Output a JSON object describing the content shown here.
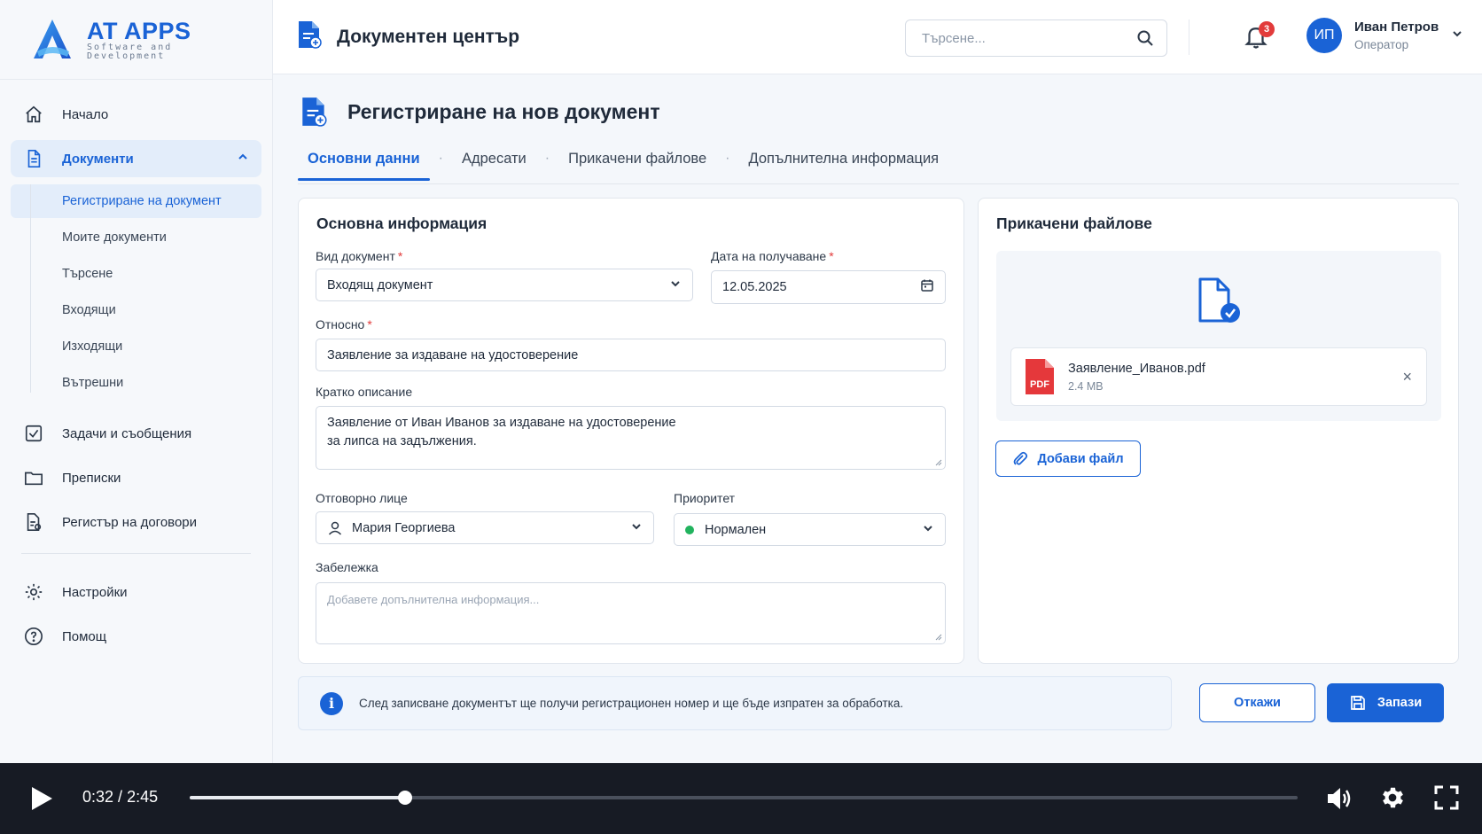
{
  "brand": {
    "title": "AT APPS",
    "subtitle_line1": "Software and",
    "subtitle_line2": "Development"
  },
  "sidebar": {
    "items": [
      {
        "label": "Начало",
        "icon": "home-icon"
      },
      {
        "label": "Документи",
        "icon": "document-icon",
        "active": true
      },
      {
        "label": "Задачи и съобщения",
        "icon": "checkbox-icon"
      },
      {
        "label": "Преписки",
        "icon": "folder-icon"
      },
      {
        "label": "Регистър на договори",
        "icon": "contract-icon"
      },
      {
        "label": "Настройки",
        "icon": "gear-icon"
      },
      {
        "label": "Помощ",
        "icon": "help-icon"
      }
    ],
    "sub_items": [
      "Регистриране на документ",
      "Моите документи",
      "Търсене",
      "Входящи",
      "Изходящи",
      "Вътрешни"
    ]
  },
  "topbar": {
    "title": "Документен център",
    "search_placeholder": "Търсене...",
    "notifications_count": "3",
    "user": {
      "initials": "ИП",
      "name": "Иван Петров",
      "role": "Оператор"
    }
  },
  "page": {
    "title": "Регистриране на нов документ",
    "tabs": [
      "Основни данни",
      "Адресати",
      "Прикачени файлове",
      "Допълнителна информация"
    ]
  },
  "form": {
    "title": "Основна информация",
    "doc_type": {
      "label": "Вид документ",
      "value": "Входящ документ"
    },
    "date": {
      "label": "Дата на получаване",
      "value": "12.05.2025"
    },
    "subject": {
      "label": "Относно",
      "value": "Заявление за издаване на удостоверение"
    },
    "description": {
      "label": "Кратко описание",
      "line1": "Заявление от Иван Иванов за издаване на удостоверение",
      "line2": "за липса на задължения."
    },
    "responsible": {
      "label": "Отговорно лице",
      "value": "Мария Георгиева"
    },
    "priority": {
      "label": "Приоритет",
      "value": "Нормален"
    },
    "note": {
      "label": "Забележка",
      "placeholder": "Добавете допълнителна информация..."
    }
  },
  "attachments": {
    "title": "Прикачени файлове",
    "file": {
      "name": "Заявление_Иванов.pdf",
      "size": "2.4 MB",
      "type_label": "PDF"
    },
    "add_label": "Добави файл"
  },
  "info_text": "След записване документът ще получи регистрационен номер и ще бъде изпратен за обработка.",
  "actions": {
    "cancel": "Откажи",
    "save": "Запази"
  },
  "video": {
    "current": "0:32",
    "total": "2:45",
    "progress": 0.194
  },
  "colors": {
    "accent": "#1a63d6",
    "badge": "#e23b3b",
    "priority_normal": "#22b35e",
    "pdf": "#e5383b"
  }
}
